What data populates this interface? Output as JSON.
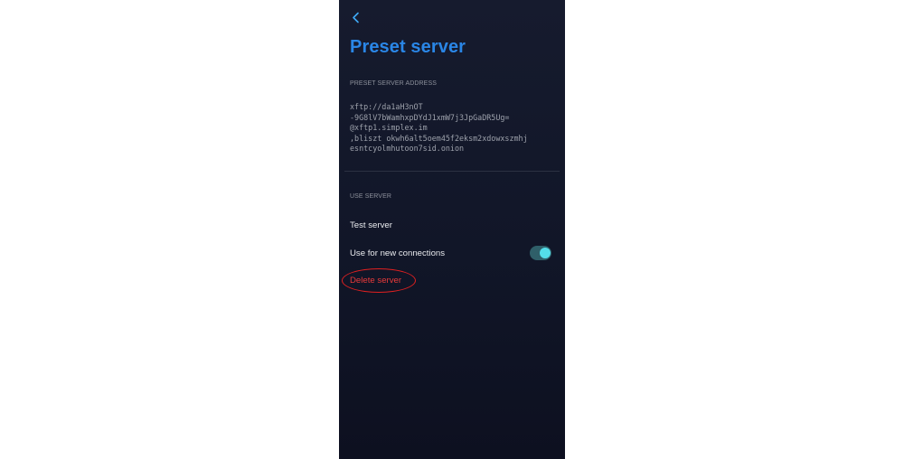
{
  "screen": {
    "title": "Preset server",
    "back_icon": "chevron-left-icon"
  },
  "address_section": {
    "label": "PRESET SERVER ADDRESS",
    "lines": [
      "xftp://da1aH3nOT",
      "-9G8lV7bWamhxpDYdJ1xmW7j3JpGaDR5Ug=",
      "@xftp1.simplex.im",
      ",bliszt okwh6alt5oem45f2eksm2xdowxszmhj",
      "esntcyolmhutoon7sid.onion"
    ]
  },
  "use_section": {
    "label": "USE SERVER",
    "test_label": "Test server",
    "use_new_label": "Use for new connections",
    "use_new_enabled": true,
    "delete_label": "Delete server"
  },
  "colors": {
    "title": "#2a86e6",
    "toggle_on": "#54dde9",
    "delete": "#e83a3a",
    "highlight": "#e02020"
  }
}
